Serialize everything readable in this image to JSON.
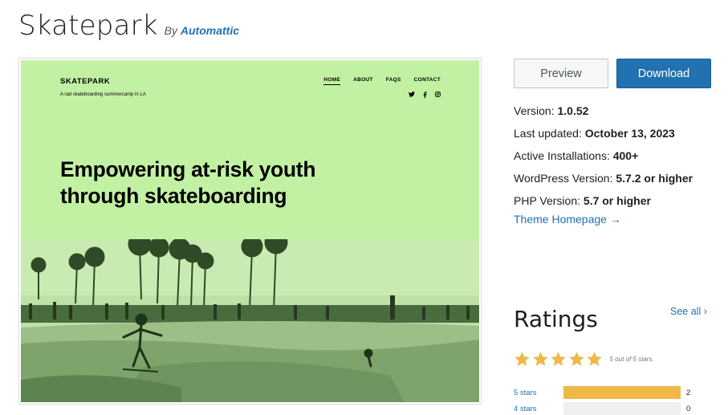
{
  "theme": {
    "name": "Skatepark",
    "by_prefix": "By",
    "author": "Automattic"
  },
  "preview_site": {
    "site_title": "SKATEPARK",
    "tagline": "A rad skateboarding summercamp in LA",
    "nav": [
      "HOME",
      "ABOUT",
      "FAQS",
      "CONTACT"
    ],
    "social_icons": [
      "twitter-icon",
      "facebook-icon",
      "instagram-icon"
    ],
    "hero_line1": "Empowering at-risk youth",
    "hero_line2": "through skateboarding"
  },
  "actions": {
    "preview_label": "Preview",
    "download_label": "Download"
  },
  "meta": {
    "version_label": "Version:",
    "version": "1.0.52",
    "updated_label": "Last updated:",
    "updated": "October 13, 2023",
    "installs_label": "Active Installations:",
    "installs": "400+",
    "wp_label": "WordPress Version:",
    "wp": "5.7.2 or higher",
    "php_label": "PHP Version:",
    "php": "5.7 or higher",
    "homepage_link": "Theme Homepage →"
  },
  "ratings": {
    "title": "Ratings",
    "see_all": "See all",
    "stars_caption": "5 out of 5 stars.",
    "star_count": 5,
    "rows": [
      {
        "label": "5 stars",
        "count": "2",
        "fraction": 1.0
      },
      {
        "label": "4 stars",
        "count": "0",
        "fraction": 0.0
      }
    ]
  },
  "colors": {
    "accent": "#2271b1",
    "preview_bg": "#c3f1a4",
    "star": "#f0b849"
  }
}
